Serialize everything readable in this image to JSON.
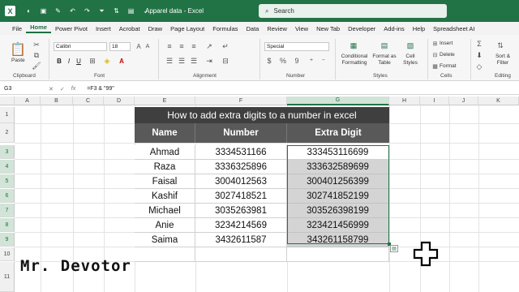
{
  "app": {
    "title": "Apparel data  -  Excel",
    "search_placeholder": "Search",
    "logo_letter": "X",
    "accent": "#217346"
  },
  "menu": [
    "File",
    "Home",
    "Power Pivot",
    "Insert",
    "Acrobat",
    "Draw",
    "Page Layout",
    "Formulas",
    "Data",
    "Review",
    "View",
    "New Tab",
    "Developer",
    "Add-ins",
    "Help",
    "Spreadsheet AI"
  ],
  "ribbon": {
    "clipboard": {
      "paste": "Paste",
      "label": "Clipboard"
    },
    "font": {
      "name": "Calibri",
      "size": "18",
      "label": "Font",
      "bold": "B",
      "italic": "I",
      "underline": "U"
    },
    "alignment": {
      "label": "Alignment"
    },
    "number": {
      "format": "Special",
      "label": "Number",
      "currency": "$",
      "percent": "%",
      "comma": "9"
    },
    "styles": {
      "conditional": "Conditional Formatting",
      "format_table": "Format as Table",
      "cell_styles": "Cell Styles",
      "label": "Styles"
    },
    "cells": {
      "insert": "Insert",
      "delete": "Delete",
      "format": "Format",
      "label": "Cells"
    },
    "editing": {
      "sort": "Sort & Filter",
      "label": "Editing"
    }
  },
  "formula_bar": {
    "name_box": "G3",
    "cancel": "✕",
    "enter": "✓",
    "fx": "fx",
    "formula": "=F3 & \"99\""
  },
  "columns": [
    "A",
    "B",
    "C",
    "D",
    "E",
    "F",
    "G",
    "H",
    "I",
    "J",
    "K"
  ],
  "rows": [
    "1",
    "2",
    "3",
    "4",
    "5",
    "6",
    "7",
    "8",
    "9",
    "10",
    "11"
  ],
  "table": {
    "banner": "How to add extra digits to a number in excel",
    "headers": [
      "Name",
      "Number",
      "Extra Digit"
    ],
    "rows": [
      [
        "Ahmad",
        "3334531166",
        "333453116699"
      ],
      [
        "Raza",
        "3336325896",
        "333632589699"
      ],
      [
        "Faisal",
        "3004012563",
        "300401256399"
      ],
      [
        "Kashif",
        "3027418521",
        "302741852199"
      ],
      [
        "Michael",
        "3035263981",
        "303526398199"
      ],
      [
        "Anie",
        "3234214569",
        "323421456999"
      ],
      [
        "Saima",
        "3432611587",
        "343261158799"
      ]
    ]
  },
  "watermark": "Mr. Devotor"
}
